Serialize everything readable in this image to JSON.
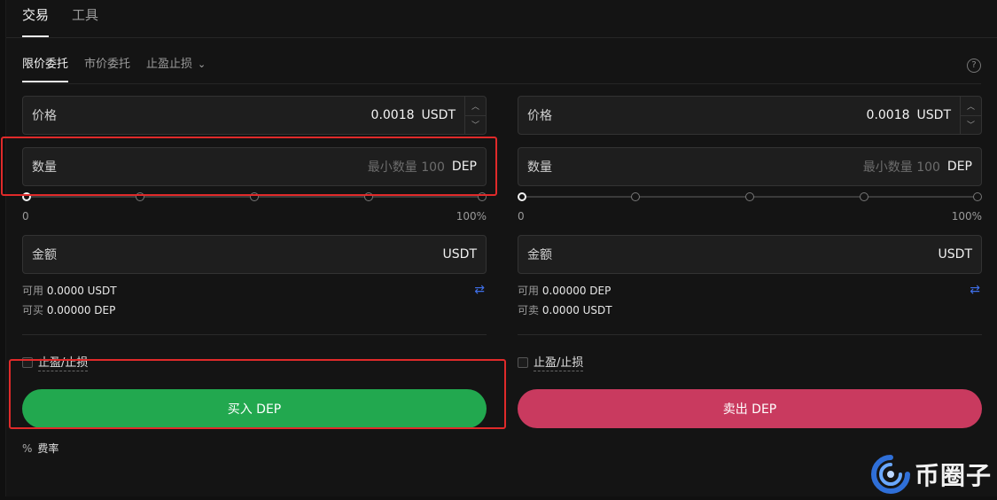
{
  "top_tabs": [
    "交易",
    "工具"
  ],
  "order_tabs": {
    "limit": "限价委托",
    "market": "市价委托",
    "tpsl": "止盈止损"
  },
  "buy": {
    "price_label": "价格",
    "price_value": "0.0018",
    "price_unit": "USDT",
    "qty_label": "数量",
    "qty_placeholder": "最小数量 100",
    "qty_unit": "DEP",
    "slider_min": "0",
    "slider_max": "100%",
    "amount_label": "金额",
    "amount_unit": "USDT",
    "avail_label": "可用",
    "avail_value": "0.0000 USDT",
    "can_label": "可买",
    "can_value": "0.00000 DEP",
    "tpsl_label": "止盈/止损",
    "button": "买入 DEP"
  },
  "sell": {
    "price_label": "价格",
    "price_value": "0.0018",
    "price_unit": "USDT",
    "qty_label": "数量",
    "qty_placeholder": "最小数量 100",
    "qty_unit": "DEP",
    "slider_min": "0",
    "slider_max": "100%",
    "amount_label": "金额",
    "amount_unit": "USDT",
    "avail_label": "可用",
    "avail_value": "0.00000 DEP",
    "can_label": "可卖",
    "can_value": "0.0000 USDT",
    "tpsl_label": "止盈/止损",
    "button": "卖出 DEP"
  },
  "fee": {
    "icon": "%",
    "label": "费率"
  },
  "watermark": "币圈子",
  "colors": {
    "buy": "#22a84f",
    "sell": "#c93a5f",
    "highlight": "#e02a2a",
    "swap_icon": "#3f6fe8"
  }
}
